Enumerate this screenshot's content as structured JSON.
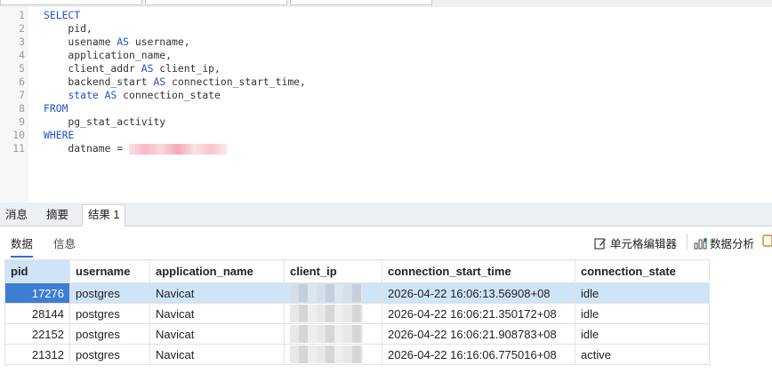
{
  "editor": {
    "lines": [
      {
        "n": "1",
        "kw": "SELECT",
        "text": ""
      },
      {
        "n": "2",
        "kw": "",
        "text": "    pid,"
      },
      {
        "n": "3",
        "kw": "",
        "text": "    usename ",
        "kw2": "AS",
        "text2": " username,"
      },
      {
        "n": "4",
        "kw": "",
        "text": "    application_name,"
      },
      {
        "n": "5",
        "kw": "",
        "text": "    client_addr ",
        "kw2": "AS",
        "text2": " client_ip,"
      },
      {
        "n": "6",
        "kw": "",
        "text": "    backend_start ",
        "kw2": "AS",
        "text2": " connection_start_time,"
      },
      {
        "n": "7",
        "kw": "",
        "text": "    ",
        "kwmid": "state",
        "kw2": " AS",
        "text2": " connection_state"
      },
      {
        "n": "8",
        "kw": "FROM",
        "text": ""
      },
      {
        "n": "9",
        "kw": "",
        "text": "    pg_stat_activity"
      },
      {
        "n": "10",
        "kw": "WHERE",
        "text": ""
      },
      {
        "n": "11",
        "kw": "",
        "text": "    datname = ",
        "redacted": true
      }
    ]
  },
  "tabs": {
    "messages": "消息",
    "summary": "摘要",
    "result": "结果 1"
  },
  "subtabs": {
    "data": "数据",
    "info": "信息"
  },
  "toolbar": {
    "cell_editor": "单元格编辑器",
    "data_analysis": "数据分析"
  },
  "table": {
    "columns": [
      "pid",
      "username",
      "application_name",
      "client_ip",
      "connection_start_time",
      "connection_state"
    ],
    "rows": [
      [
        "17276",
        "postgres",
        "Navicat",
        "",
        "2026-04-22 16:06:13.56908+08",
        "idle"
      ],
      [
        "28144",
        "postgres",
        "Navicat",
        "",
        "2026-04-22 16:06:21.350172+08",
        "idle"
      ],
      [
        "22152",
        "postgres",
        "Navicat",
        "",
        "2026-04-22 16:06:21.908783+08",
        "idle"
      ],
      [
        "21312",
        "postgres",
        "Navicat",
        "",
        "2026-04-22 16:16:06.775016+08",
        "active"
      ]
    ]
  },
  "colors": {
    "keyword": "#1f4fd6",
    "selection": "#cfe4f7",
    "selected_cell": "#3d7ed4"
  }
}
